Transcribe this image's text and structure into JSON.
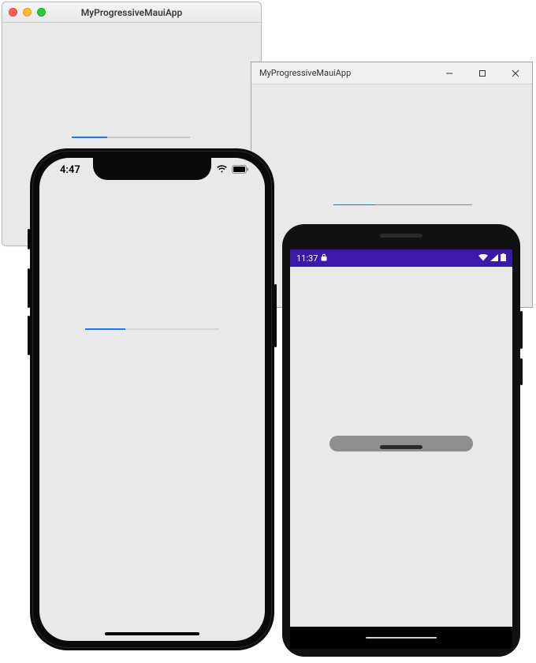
{
  "app_title": "MyProgressiveMauiApp",
  "progress_percent": 30,
  "colors": {
    "progress_fill": "#1976ff",
    "progress_track": "#c7c7c7",
    "android_status_bg": "#3b1aa8"
  },
  "macos": {
    "title": "MyProgressiveMauiApp"
  },
  "windows": {
    "title": "MyProgressiveMauiApp"
  },
  "ios": {
    "status_time": "4:47"
  },
  "android": {
    "status_time": "11:37"
  }
}
